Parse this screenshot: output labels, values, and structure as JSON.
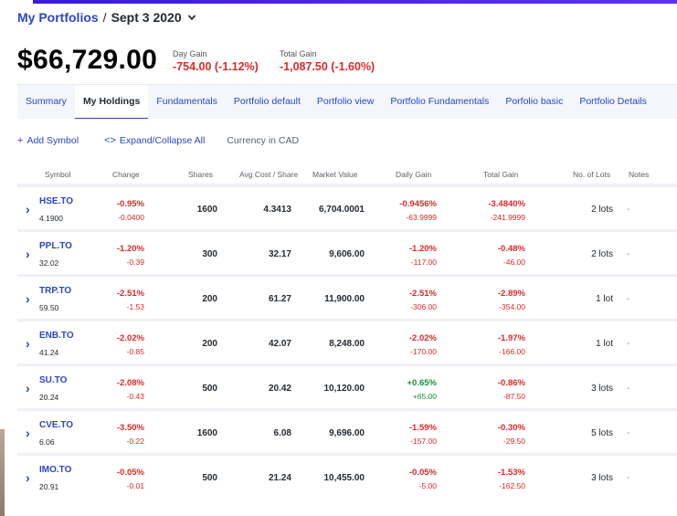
{
  "breadcrumb": {
    "root": "My Portfolios",
    "separator": "/",
    "current": "Sept 3 2020"
  },
  "summary": {
    "total_value": "$66,729.00",
    "day_gain_label": "Day Gain",
    "day_gain_value": "-754.00 (-1.12%)",
    "total_gain_label": "Total Gain",
    "total_gain_value": "-1,087.50 (-1.60%)"
  },
  "tabs": [
    {
      "label": "Summary",
      "active": false
    },
    {
      "label": "My Holdings",
      "active": true
    },
    {
      "label": "Fundamentals",
      "active": false
    },
    {
      "label": "Portfolio default",
      "active": false
    },
    {
      "label": "Portfolio view",
      "active": false
    },
    {
      "label": "Portfolio Fundamentals",
      "active": false
    },
    {
      "label": "Porfolio basic",
      "active": false
    },
    {
      "label": "Portfolio Details",
      "active": false
    }
  ],
  "actions": {
    "add_symbol": "Add Symbol",
    "expand_collapse": "Expand/Collapse All",
    "currency": "Currency in CAD"
  },
  "columns": {
    "symbol": "Symbol",
    "change": "Change",
    "shares": "Shares",
    "avg_cost": "Avg Cost / Share",
    "market_value": "Market Value",
    "daily_gain": "Daily Gain",
    "total_gain": "Total Gain",
    "lots": "No. of Lots",
    "notes": "Notes"
  },
  "holdings": [
    {
      "symbol": "HSE.TO",
      "price": "4.1900",
      "change_pct": "-0.95%",
      "change_abs": "-0.0400",
      "shares": "1600",
      "avg_cost": "4.3413",
      "market_value": "6,704.0001",
      "daily_gain_pct": "-0.9456%",
      "daily_gain_abs": "-63.9999",
      "total_gain_pct": "-3.4840%",
      "total_gain_abs": "-241.9999",
      "lots": "2 lots",
      "notes": "-"
    },
    {
      "symbol": "PPL.TO",
      "price": "32.02",
      "change_pct": "-1.20%",
      "change_abs": "-0.39",
      "shares": "300",
      "avg_cost": "32.17",
      "market_value": "9,606.00",
      "daily_gain_pct": "-1.20%",
      "daily_gain_abs": "-117.00",
      "total_gain_pct": "-0.48%",
      "total_gain_abs": "-46.00",
      "lots": "2 lots",
      "notes": "-"
    },
    {
      "symbol": "TRP.TO",
      "price": "59.50",
      "change_pct": "-2.51%",
      "change_abs": "-1.53",
      "shares": "200",
      "avg_cost": "61.27",
      "market_value": "11,900.00",
      "daily_gain_pct": "-2.51%",
      "daily_gain_abs": "-306.00",
      "total_gain_pct": "-2.89%",
      "total_gain_abs": "-354.00",
      "lots": "1 lot",
      "notes": "-"
    },
    {
      "symbol": "ENB.TO",
      "price": "41.24",
      "change_pct": "-2.02%",
      "change_abs": "-0.85",
      "shares": "200",
      "avg_cost": "42.07",
      "market_value": "8,248.00",
      "daily_gain_pct": "-2.02%",
      "daily_gain_abs": "-170.00",
      "total_gain_pct": "-1.97%",
      "total_gain_abs": "-166.00",
      "lots": "1 lot",
      "notes": "-"
    },
    {
      "symbol": "SU.TO",
      "price": "20.24",
      "change_pct": "-2.08%",
      "change_abs": "-0.43",
      "shares": "500",
      "avg_cost": "20.42",
      "market_value": "10,120.00",
      "daily_gain_pct": "+0.65%",
      "daily_gain_abs": "+65.00",
      "total_gain_pct": "-0.86%",
      "total_gain_abs": "-87.50",
      "lots": "3 lots",
      "notes": "-"
    },
    {
      "symbol": "CVE.TO",
      "price": "6.06",
      "change_pct": "-3.50%",
      "change_abs": "-0.22",
      "shares": "1600",
      "avg_cost": "6.08",
      "market_value": "9,696.00",
      "daily_gain_pct": "-1.59%",
      "daily_gain_abs": "-157.00",
      "total_gain_pct": "-0.30%",
      "total_gain_abs": "-29.50",
      "lots": "5 lots",
      "notes": "-"
    },
    {
      "symbol": "IMO.TO",
      "price": "20.91",
      "change_pct": "-0.05%",
      "change_abs": "-0.01",
      "shares": "500",
      "avg_cost": "21.24",
      "market_value": "10,455.00",
      "daily_gain_pct": "-0.05%",
      "daily_gain_abs": "-5.00",
      "total_gain_pct": "-1.53%",
      "total_gain_abs": "-162.50",
      "lots": "3 lots",
      "notes": "-"
    }
  ],
  "colors": {
    "link": "#2b46c7",
    "negative": "#e02828",
    "positive": "#1a8f3a",
    "accent": "#3a1cd6"
  }
}
